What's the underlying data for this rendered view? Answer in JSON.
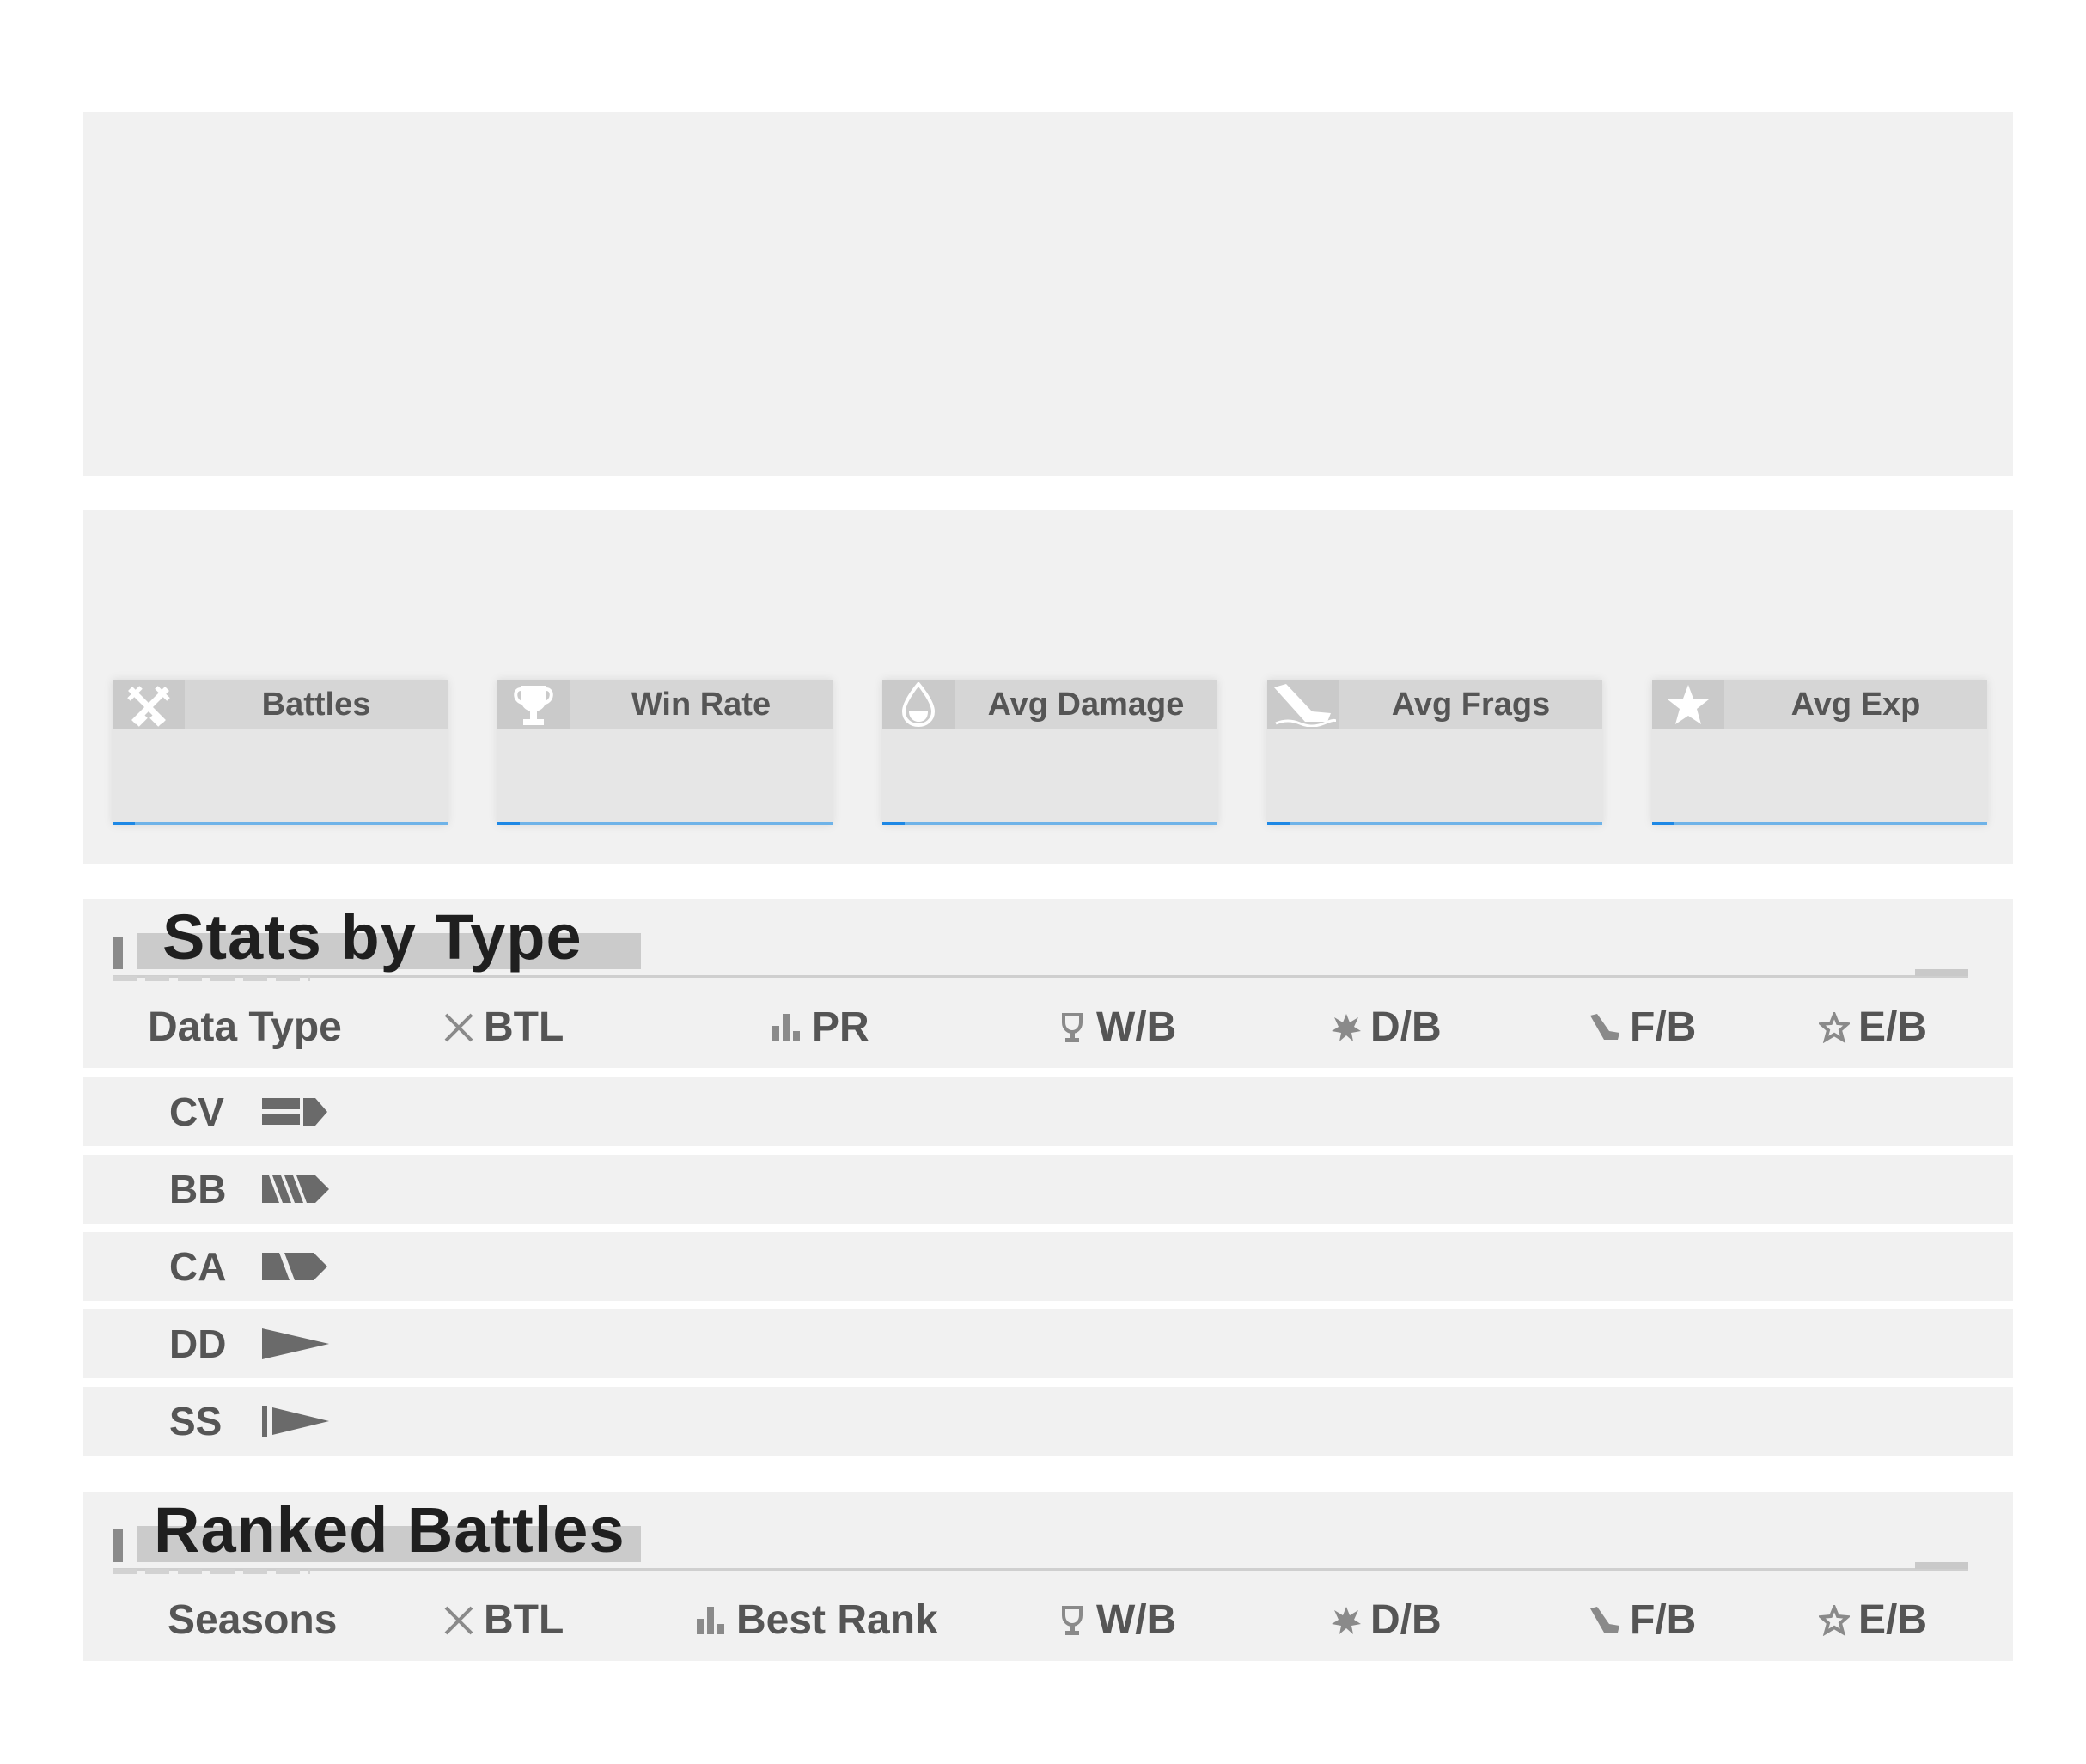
{
  "summary": {
    "cards": [
      {
        "label": "Battles",
        "icon": "battles-icon"
      },
      {
        "label": "Win Rate",
        "icon": "trophy-icon"
      },
      {
        "label": "Avg Damage",
        "icon": "damage-drop-icon"
      },
      {
        "label": "Avg Frags",
        "icon": "sinking-ship-icon"
      },
      {
        "label": "Avg Exp",
        "icon": "star-icon"
      }
    ]
  },
  "stats_by_type": {
    "title": "Stats by Type",
    "columns": {
      "data_type": "Data Type",
      "btl": "BTL",
      "pr": "PR",
      "wb": "W/B",
      "db": "D/B",
      "fb": "F/B",
      "eb": "E/B"
    },
    "rows": [
      {
        "code": "CV",
        "icon": "carrier-icon"
      },
      {
        "code": "BB",
        "icon": "battleship-icon"
      },
      {
        "code": "CA",
        "icon": "cruiser-icon"
      },
      {
        "code": "DD",
        "icon": "destroyer-icon"
      },
      {
        "code": "SS",
        "icon": "submarine-icon"
      }
    ]
  },
  "ranked": {
    "title": "Ranked Battles",
    "columns": {
      "seasons": "Seasons",
      "btl": "BTL",
      "best_rank": "Best Rank",
      "wb": "W/B",
      "db": "D/B",
      "fb": "F/B",
      "eb": "E/B"
    }
  },
  "colors": {
    "panel": "#f1f1f1",
    "card": "#e6e6e6",
    "accent": "#6fb3e8",
    "text": "#555555",
    "title": "#1f1f1f"
  }
}
